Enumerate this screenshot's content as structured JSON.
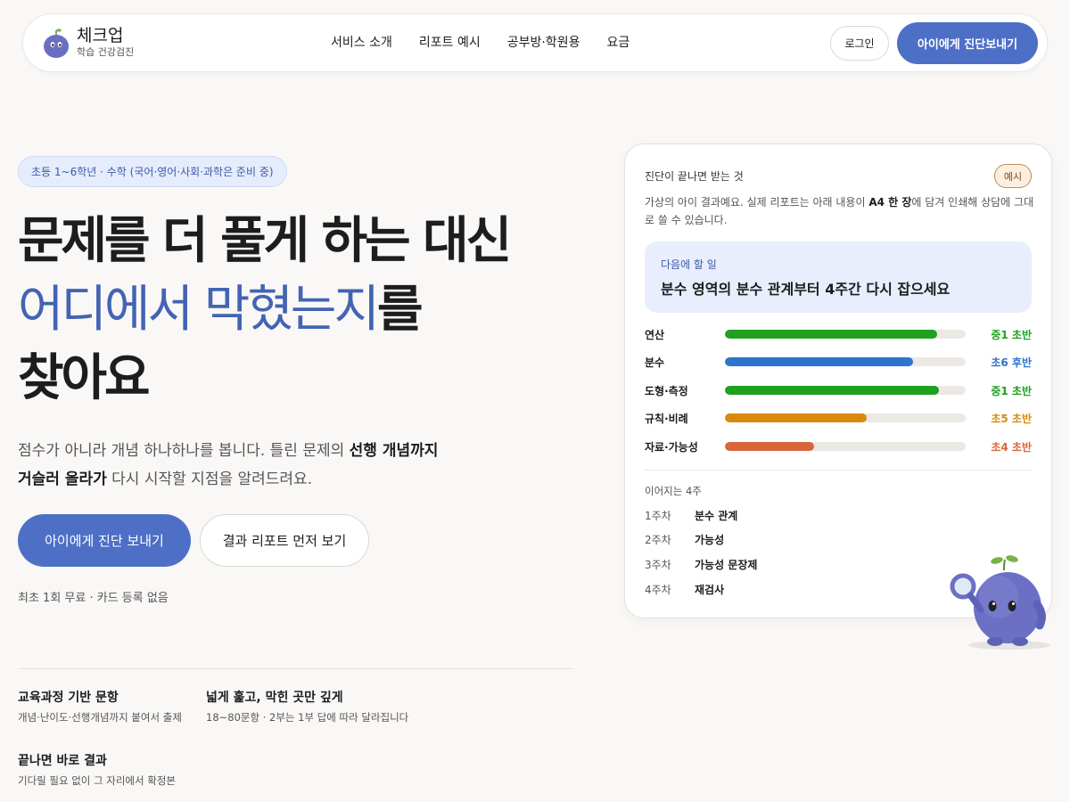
{
  "nav": {
    "brand_name": "체크업",
    "brand_sub": "학습 건강검진",
    "menu": [
      "서비스 소개",
      "리포트 예시",
      "공부방·학원용",
      "요금"
    ],
    "login": "로그인",
    "cta": "아이에게 진단보내기"
  },
  "hero": {
    "pill": "초등 1~6학년 · 수학 (국어·영어·사회·과학은 준비 중)",
    "title_line1": "문제를 더 풀게 하는 대신",
    "title_line2_blue": "어디에서 막혔는지",
    "title_line2_rest": "를",
    "title_line3": "찾아요",
    "sub_part1": "점수가 아니라 개념 하나하나를 봅니다. 틀린 문제의 ",
    "sub_bold1": "선행 개념까지",
    "sub_bold2": "거슬러 올라가",
    "sub_part2": " 다시 시작할 지점을 알려드려요.",
    "cta_primary": "아이에게 진단 보내기",
    "cta_secondary": "결과 리포트 먼저 보기",
    "note": "최초 1회 무료 · 카드 등록 없음"
  },
  "features": [
    {
      "title": "교육과정 기반 문항",
      "desc": "개념·난이도·선행개념까지 붙여서 출제"
    },
    {
      "title": "넓게 훑고, 막힌 곳만 깊게",
      "desc": "18~80문항 · 2부는 1부 답에 따라 달라집니다"
    },
    {
      "title": "끝나면 바로 결과",
      "desc": "기다릴 필요 없이 그 자리에서 확정본"
    }
  ],
  "card": {
    "head": "진단이 끝나면 받는 것",
    "badge": "예시",
    "desc_part1": "가상의 아이 결과예요. 실제 리포트는 아래 내용이 ",
    "desc_bold": "A4 한 장",
    "desc_part2": "에 담겨 인쇄해 상담에 그대로 쓸 수 있습니다.",
    "next_label": "다음에 할 일",
    "next_text": "분수 영역의 분수 관계부터 4주간 다시 잡으세요",
    "skills": [
      {
        "name": "연산",
        "level": "중1 초반",
        "fill": 0.88,
        "color": "#1fa01f"
      },
      {
        "name": "분수",
        "level": "초6 후반",
        "fill": 0.78,
        "color": "#2e74cc"
      },
      {
        "name": "도형·측정",
        "level": "중1 초반",
        "fill": 0.89,
        "color": "#1fa01f"
      },
      {
        "name": "규칙·비례",
        "level": "초5 초반",
        "fill": 0.59,
        "color": "#d98a0b"
      },
      {
        "name": "자료·가능성",
        "level": "초4 초반",
        "fill": 0.37,
        "color": "#d9663a"
      }
    ],
    "weeks_label": "이어지는 4주",
    "weeks": [
      {
        "num": "1주차",
        "task": "분수 관계"
      },
      {
        "num": "2주차",
        "task": "가능성"
      },
      {
        "num": "3주차",
        "task": "가능성 문장제"
      },
      {
        "num": "4주차",
        "task": "재검사"
      }
    ]
  }
}
